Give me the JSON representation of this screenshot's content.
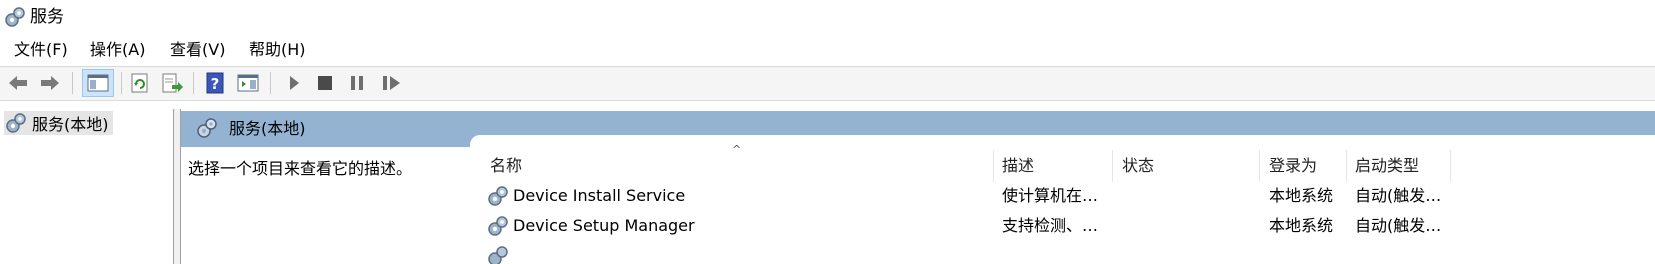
{
  "window": {
    "title": "服务",
    "icon": "services-gear-icon"
  },
  "menu": [
    "文件(F)",
    "操作(A)",
    "查看(V)",
    "帮助(H)"
  ],
  "toolbar": {
    "buttons": [
      "back-arrow-icon",
      "forward-arrow-icon",
      "show-hide-console-tree-icon",
      "refresh-icon",
      "export-list-icon",
      "help-icon",
      "show-action-pane-icon",
      "start-service-icon",
      "stop-service-icon",
      "pause-service-icon",
      "restart-service-icon"
    ]
  },
  "tree": {
    "item_label": "服务(本地)"
  },
  "main": {
    "header_title": "服务(本地)",
    "description": "选择一个项目来查看它的描述。"
  },
  "table": {
    "columns": [
      "名称",
      "描述",
      "状态",
      "登录为",
      "启动类型"
    ],
    "rows": [
      {
        "name": "Device Install Service",
        "description": "使计算机在…",
        "status": "",
        "logon": "本地系统",
        "startup": "自动(触发…"
      },
      {
        "name": "Device Setup Manager",
        "description": "支持检测、…",
        "status": "",
        "logon": "本地系统",
        "startup": "自动(触发…"
      }
    ]
  },
  "colors": {
    "header_blue": "#94b3d3",
    "toolbar_bg": "#f5f5f5",
    "tree_selected": "#e5e5e5"
  }
}
